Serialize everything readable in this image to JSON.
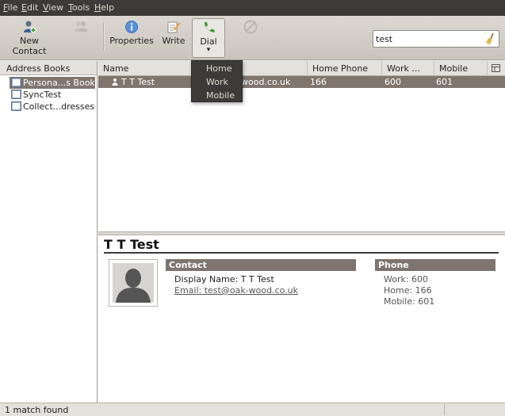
{
  "menubar": {
    "items": [
      {
        "accel": "F",
        "rest": "ile"
      },
      {
        "accel": "E",
        "rest": "dit"
      },
      {
        "accel": "V",
        "rest": "iew"
      },
      {
        "accel": "T",
        "rest": "ools"
      },
      {
        "accel": "H",
        "rest": "elp"
      }
    ]
  },
  "toolbar": {
    "new_contact": "New Contact",
    "properties": "Properties",
    "write": "Write",
    "dial": "Dial",
    "dial_arrow": "▾"
  },
  "search": {
    "value": "test"
  },
  "address_books": {
    "header": "Address Books",
    "items": [
      {
        "label": "Persona...s Book",
        "selected": true
      },
      {
        "label": "SyncTest",
        "selected": false
      },
      {
        "label": "Collect...dresses",
        "selected": false
      }
    ]
  },
  "results": {
    "columns": [
      "Name",
      "Home Phone",
      "Work ...",
      "Mobile"
    ],
    "rows": [
      {
        "name": "T T Test",
        "email": "wood.co.uk",
        "home": "166",
        "work": "600",
        "mobile": "601"
      }
    ]
  },
  "dial_menu": {
    "items": [
      "Home",
      "Work",
      "Mobile"
    ]
  },
  "card": {
    "name": "T T Test",
    "contact_header": "Contact",
    "display_name": "Display Name: T T Test",
    "email": "Email: test@oak-wood.co.uk",
    "phone_header": "Phone",
    "work": "Work: 600",
    "home": "Home: 166",
    "mobile": "Mobile: 601"
  },
  "status": {
    "text": "1 match found"
  },
  "colors": {
    "menubar_bg": "#3c3b37",
    "selection": "#80766e",
    "section_header": "#7e7470"
  }
}
